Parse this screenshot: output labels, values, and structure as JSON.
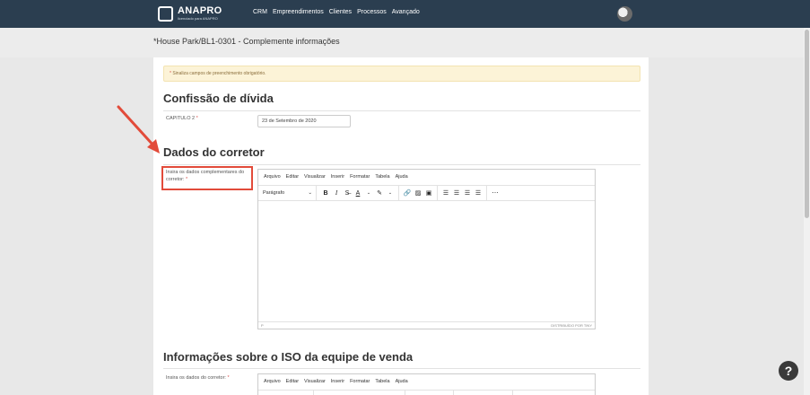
{
  "brand": {
    "name": "ANAPRO",
    "tagline": "licenciado para ANAPRO"
  },
  "nav": [
    "CRM",
    "Empreendimentos",
    "Clientes",
    "Processos",
    "Avançado"
  ],
  "page_title": "*House Park/BL1-0301 - Complemente informações",
  "notice": {
    "asterisk": "*",
    "text": " Sinaliza campos de preenchimento obrigatório."
  },
  "section1": {
    "title": "Confissão de dívida",
    "label": "CAPITULO 2",
    "required": "*",
    "value": "23 de Setembro de 2020"
  },
  "section2": {
    "title": "Dados do corretor",
    "label": "Insira os dados complementares do corretor:",
    "required": "*"
  },
  "section3": {
    "title": "Informações sobre o ISO da equipe de venda",
    "label": "Insira os dados do corretor:",
    "required": "*"
  },
  "editor": {
    "menu": [
      "Arquivo",
      "Editar",
      "Visualizar",
      "Inserir",
      "Formatar",
      "Tabela",
      "Ajuda"
    ],
    "format_select": "Parágrafo",
    "status_left": "P",
    "status_right": "DISTRIBUÍDO POR TINY"
  },
  "icons": [
    "bold-icon",
    "italic-icon",
    "strikethrough-icon",
    "text-color-icon",
    "highlight-icon",
    "link-icon",
    "image-icon",
    "media-icon",
    "align-left-icon",
    "align-center-icon",
    "align-right-icon",
    "align-justify-icon",
    "more-icon",
    "help-icon"
  ],
  "colors": {
    "topbar": "#2b3e50",
    "notice_bg": "#fcf3d7",
    "highlight": "#e24b3a"
  }
}
